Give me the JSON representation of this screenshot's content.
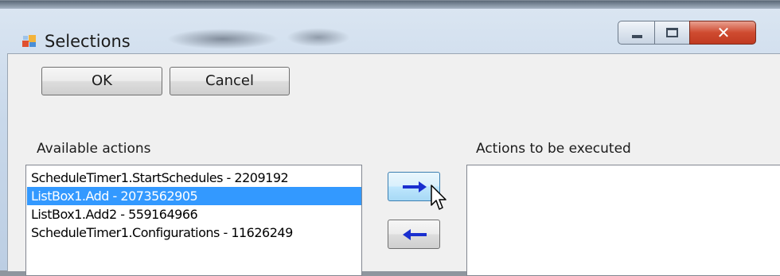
{
  "window": {
    "title": "Selections",
    "colors": {
      "selection": "#3399ff",
      "arrow": "#1a2fcf",
      "close_button": "#c84a32"
    }
  },
  "buttons": {
    "ok": "OK",
    "cancel": "Cancel"
  },
  "available": {
    "label": "Available actions",
    "items": [
      "ScheduleTimer1.StartSchedules - 2209192",
      "ListBox1.Add - 2073562905",
      "ListBox1.Add2 - 559164966",
      "ScheduleTimer1.Configurations - 11626249"
    ],
    "selected_index": 1
  },
  "execute": {
    "label": "Actions to be executed",
    "items": []
  },
  "icons": {
    "app": "form-window-icon",
    "move_right": "arrow-right-icon",
    "move_left": "arrow-left-icon",
    "cursor": "mouse-pointer-icon"
  }
}
